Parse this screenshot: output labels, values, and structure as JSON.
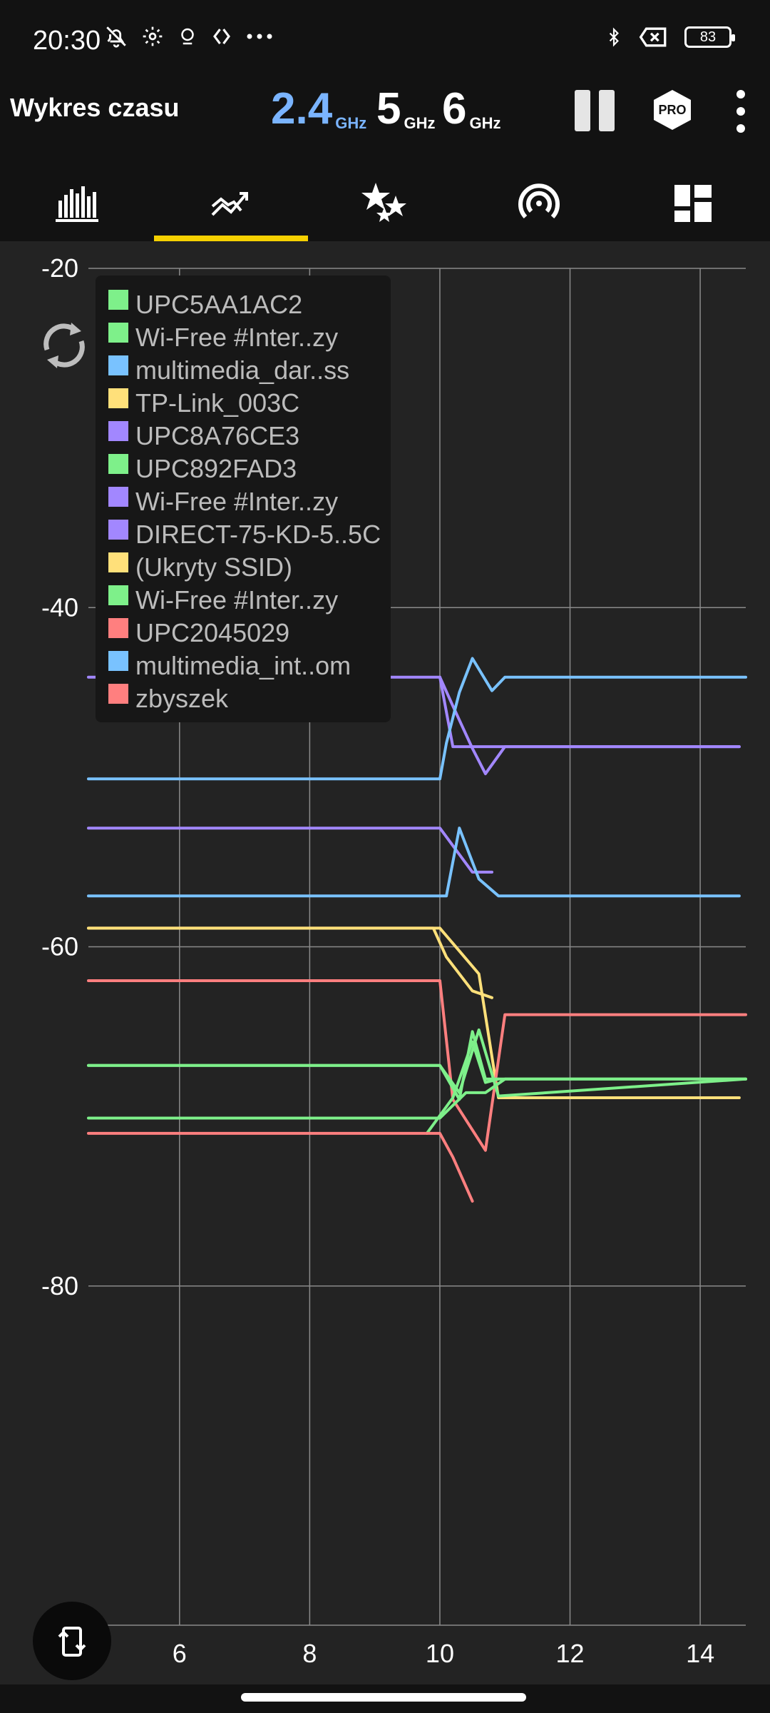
{
  "status_bar": {
    "time": "20:30",
    "left_icons": [
      "bell-off-icon",
      "gear-icon",
      "shield-icon",
      "diamond-arrows-icon",
      "more-dots-icon"
    ],
    "right_icons": [
      "bluetooth-icon",
      "no-sim-icon"
    ],
    "battery": "83"
  },
  "app_bar": {
    "title": "Wykres czasu",
    "bands": [
      {
        "value": "2.4",
        "unit": "GHz",
        "active": true
      },
      {
        "value": "5",
        "unit": "GHz",
        "active": false
      },
      {
        "value": "6",
        "unit": "GHz",
        "active": false
      }
    ],
    "pro_label": "PRO"
  },
  "tabs": [
    {
      "name": "channel-graph",
      "icon": "bar-chart-icon"
    },
    {
      "name": "time-graph",
      "icon": "trend-line-icon",
      "selected": true
    },
    {
      "name": "channel-rating",
      "icon": "stars-icon"
    },
    {
      "name": "access-points",
      "icon": "signal-icon"
    },
    {
      "name": "dashboard",
      "icon": "grid-icon"
    }
  ],
  "colors": {
    "green": "#7ef08a",
    "blue": "#79c2ff",
    "yellow": "#ffe07a",
    "purple": "#a287ff",
    "red": "#ff7f7f",
    "accent": "#f5d000",
    "band_active": "#7ab4ff"
  },
  "legend": [
    {
      "label": "UPC5AA1AC2",
      "color": "#7ef08a"
    },
    {
      "label": "Wi-Free #Inter..zy",
      "color": "#7ef08a"
    },
    {
      "label": "multimedia_dar..ss",
      "color": "#79c2ff"
    },
    {
      "label": "TP-Link_003C",
      "color": "#ffe07a"
    },
    {
      "label": "UPC8A76CE3",
      "color": "#a287ff"
    },
    {
      "label": "UPC892FAD3",
      "color": "#7ef08a"
    },
    {
      "label": "Wi-Free #Inter..zy",
      "color": "#a287ff"
    },
    {
      "label": "DIRECT-75-KD-5..5C",
      "color": "#a287ff"
    },
    {
      "label": "(Ukryty SSID)",
      "color": "#ffe07a"
    },
    {
      "label": "Wi-Free #Inter..zy",
      "color": "#7ef08a"
    },
    {
      "label": "UPC2045029",
      "color": "#ff7f7f"
    },
    {
      "label": "multimedia_int..om",
      "color": "#79c2ff"
    },
    {
      "label": "zbyszek",
      "color": "#ff7f7f"
    }
  ],
  "chart_data": {
    "type": "line",
    "xlim": [
      4.6,
      14.7
    ],
    "ylim": [
      -100,
      -20
    ],
    "x_ticks": [
      6,
      8,
      10,
      12,
      14
    ],
    "y_ticks": [
      -20,
      -40,
      -60,
      -80,
      -100
    ],
    "y_tick_labels": [
      "-20",
      "-40",
      "-60",
      "-80",
      "-100"
    ],
    "x_tick_labels": [
      "6",
      "8",
      "10",
      "12",
      "14"
    ],
    "grid": true,
    "legend_position": "top-left",
    "series": [
      {
        "color": "#a287ff",
        "x": [
          4.6,
          10.0,
          10.2,
          10.5,
          10.7,
          11.0,
          14.6
        ],
        "y": [
          -44.1,
          -44.1,
          -45.8,
          -48.3,
          -49.8,
          -48.2,
          -48.2
        ]
      },
      {
        "color": "#a287ff",
        "x": [
          10.0,
          10.2,
          14.6
        ],
        "y": [
          -44.1,
          -48.2,
          -48.2
        ]
      },
      {
        "color": "#79c2ff",
        "x": [
          4.6,
          10.0,
          10.1,
          10.3,
          10.5,
          10.8,
          11.0,
          14.7
        ],
        "y": [
          -50.1,
          -50.1,
          -48.0,
          -45.0,
          -43.0,
          -44.9,
          -44.1,
          -44.1
        ]
      },
      {
        "color": "#a287ff",
        "x": [
          4.6,
          10.0,
          10.5,
          10.8
        ],
        "y": [
          -53.0,
          -53.0,
          -55.6,
          -55.6
        ]
      },
      {
        "color": "#79c2ff",
        "x": [
          4.6,
          10.1,
          10.3,
          10.6,
          10.9,
          14.6
        ],
        "y": [
          -57.0,
          -57.0,
          -53.0,
          -56.0,
          -57.0,
          -57.0
        ]
      },
      {
        "color": "#ffe07a",
        "x": [
          4.6,
          9.9,
          10.1,
          10.5,
          10.8
        ],
        "y": [
          -58.9,
          -58.9,
          -60.6,
          -62.6,
          -63.0
        ]
      },
      {
        "color": "#ffe07a",
        "x": [
          4.6,
          10.0,
          10.6,
          10.9,
          11.0,
          14.6
        ],
        "y": [
          -58.9,
          -58.9,
          -61.6,
          -68.9,
          -68.9,
          -68.9
        ]
      },
      {
        "color": "#ff7f7f",
        "x": [
          4.6,
          10.0,
          10.2,
          10.7,
          11.0,
          14.7
        ],
        "y": [
          -62.0,
          -62.0,
          -69.0,
          -72.0,
          -64.0,
          -64.0
        ]
      },
      {
        "color": "#7ef08a",
        "x": [
          4.6,
          10.0,
          10.3,
          10.5,
          10.7,
          14.7
        ],
        "y": [
          -67.0,
          -67.0,
          -69.0,
          -65.0,
          -67.8,
          -67.8
        ]
      },
      {
        "color": "#7ef08a",
        "x": [
          4.6,
          10.0,
          10.3,
          10.6,
          10.9,
          14.7
        ],
        "y": [
          -67.0,
          -67.0,
          -68.6,
          -64.9,
          -68.8,
          -67.8
        ]
      },
      {
        "color": "#7ef08a",
        "x": [
          4.6,
          9.8,
          10.0,
          10.4,
          10.7,
          11.0,
          14.7
        ],
        "y": [
          -70.1,
          -70.1,
          -70.1,
          -68.6,
          -68.6,
          -67.8,
          -67.8
        ]
      },
      {
        "color": "#7ef08a",
        "x": [
          9.8,
          10.2,
          10.5,
          10.7,
          10.9
        ],
        "y": [
          -71.0,
          -68.9,
          -65.6,
          -68.0,
          -67.8
        ]
      },
      {
        "color": "#ff7f7f",
        "x": [
          4.6,
          9.8,
          10.0,
          10.2,
          10.5
        ],
        "y": [
          -71.0,
          -71.0,
          -71.0,
          -72.4,
          -75.0
        ]
      }
    ]
  }
}
